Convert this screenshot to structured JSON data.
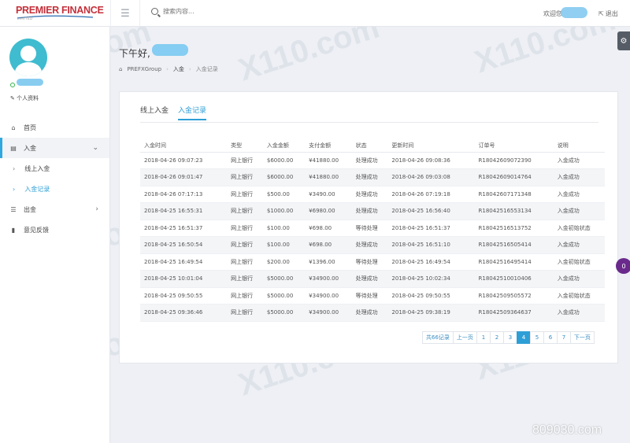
{
  "header": {
    "logo_text": "PREMIER FINANCE",
    "logo_sub": "LIMITED",
    "search_placeholder": "搜索内容...",
    "welcome": "欢迎您",
    "logout": "退出"
  },
  "sidebar": {
    "profile_link": "个人资料",
    "items": [
      {
        "label": "首页",
        "icon": "home-icon"
      },
      {
        "label": "入金",
        "icon": "card-icon"
      },
      {
        "label": "线上入金"
      },
      {
        "label": "入金记录"
      },
      {
        "label": "出金",
        "icon": "list-icon"
      },
      {
        "label": "意见反馈",
        "icon": "file-icon"
      }
    ]
  },
  "page": {
    "greeting": "下午好,",
    "breadcrumb": [
      "PREFXGroup",
      "入金",
      "入金记录"
    ]
  },
  "tabs": [
    "线上入金",
    "入金记录"
  ],
  "table": {
    "headers": [
      "入金时间",
      "类型",
      "入金金额",
      "支付金额",
      "状态",
      "更新时间",
      "订单号",
      "说明"
    ],
    "rows": [
      [
        "2018-04-26 09:07:23",
        "网上银行",
        "$6000.00",
        "¥41880.00",
        "处理成功",
        "2018-04-26 09:08:36",
        "R18042609072390",
        "入金成功"
      ],
      [
        "2018-04-26 09:01:47",
        "网上银行",
        "$6000.00",
        "¥41880.00",
        "处理成功",
        "2018-04-26 09:03:08",
        "R18042609014764",
        "入金成功"
      ],
      [
        "2018-04-26 07:17:13",
        "网上银行",
        "$500.00",
        "¥3490.00",
        "处理成功",
        "2018-04-26 07:19:18",
        "R18042607171348",
        "入金成功"
      ],
      [
        "2018-04-25 16:55:31",
        "网上银行",
        "$1000.00",
        "¥6980.00",
        "处理成功",
        "2018-04-25 16:56:40",
        "R18042516553134",
        "入金成功"
      ],
      [
        "2018-04-25 16:51:37",
        "网上银行",
        "$100.00",
        "¥698.00",
        "等待处理",
        "2018-04-25 16:51:37",
        "R18042516513752",
        "入金初始状态"
      ],
      [
        "2018-04-25 16:50:54",
        "网上银行",
        "$100.00",
        "¥698.00",
        "处理成功",
        "2018-04-25 16:51:10",
        "R18042516505414",
        "入金成功"
      ],
      [
        "2018-04-25 16:49:54",
        "网上银行",
        "$200.00",
        "¥1396.00",
        "等待处理",
        "2018-04-25 16:49:54",
        "R18042516495414",
        "入金初始状态"
      ],
      [
        "2018-04-25 10:01:04",
        "网上银行",
        "$5000.00",
        "¥34900.00",
        "处理成功",
        "2018-04-25 10:02:34",
        "R18042510010406",
        "入金成功"
      ],
      [
        "2018-04-25 09:50:55",
        "网上银行",
        "$5000.00",
        "¥34900.00",
        "等待处理",
        "2018-04-25 09:50:55",
        "R18042509505572",
        "入金初始状态"
      ],
      [
        "2018-04-25 09:36:46",
        "网上银行",
        "$5000.00",
        "¥34900.00",
        "处理成功",
        "2018-04-25 09:38:19",
        "R18042509364637",
        "入金成功"
      ]
    ]
  },
  "pagination": {
    "total": "共66记录",
    "prev": "上一页",
    "pages": [
      "1",
      "2",
      "3",
      "4",
      "5",
      "6",
      "7"
    ],
    "current": "4",
    "next": "下一页"
  },
  "chat_badge": "0",
  "watermarks": {
    "brand": "X110.com",
    "corner": "809030.com"
  },
  "colors": {
    "accent": "#2e9fd6",
    "amount": "#d9423a",
    "success": "#3aa142",
    "pending": "#e58a2c",
    "brand": "#c4303a"
  }
}
